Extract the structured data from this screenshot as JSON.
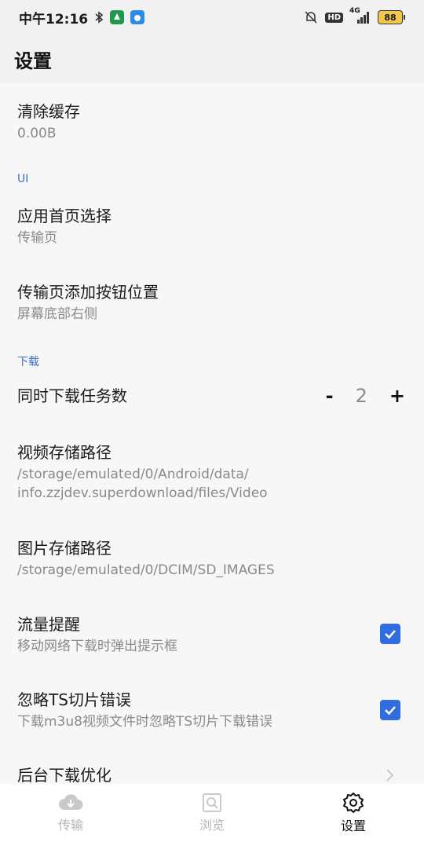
{
  "status": {
    "time": "中午12:16",
    "hd": "HD",
    "net": "4G",
    "battery": "88"
  },
  "header": {
    "title": "设置"
  },
  "settings": {
    "clear_cache": {
      "title": "清除缓存",
      "sub": "0.00B"
    },
    "section_ui": "UI",
    "home_page": {
      "title": "应用首页选择",
      "sub": "传输页"
    },
    "add_btn_pos": {
      "title": "传输页添加按钮位置",
      "sub": "屏幕底部右侧"
    },
    "section_download": "下载",
    "concurrent": {
      "title": "同时下载任务数",
      "minus": "-",
      "value": "2",
      "plus": "+"
    },
    "video_path": {
      "title": "视频存储路径",
      "sub1": "/storage/emulated/0/Android/data/",
      "sub2": "info.zzjdev.superdownload/files/Video"
    },
    "image_path": {
      "title": "图片存储路径",
      "sub": "/storage/emulated/0/DCIM/SD_IMAGES"
    },
    "traffic_alert": {
      "title": "流量提醒",
      "sub": "移动网络下载时弹出提示框",
      "checked": true
    },
    "ignore_ts": {
      "title": "忽略TS切片错误",
      "sub": "下载m3u8视频文件时忽略TS切片下载错误",
      "checked": true
    },
    "bg_opt": {
      "title": "后台下载优化"
    }
  },
  "nav": {
    "transfer": "传输",
    "browse": "浏览",
    "settings": "设置"
  },
  "colors": {
    "accent": "#2f6de1",
    "section": "#3b6fc9",
    "muted": "#8a8a8a"
  }
}
